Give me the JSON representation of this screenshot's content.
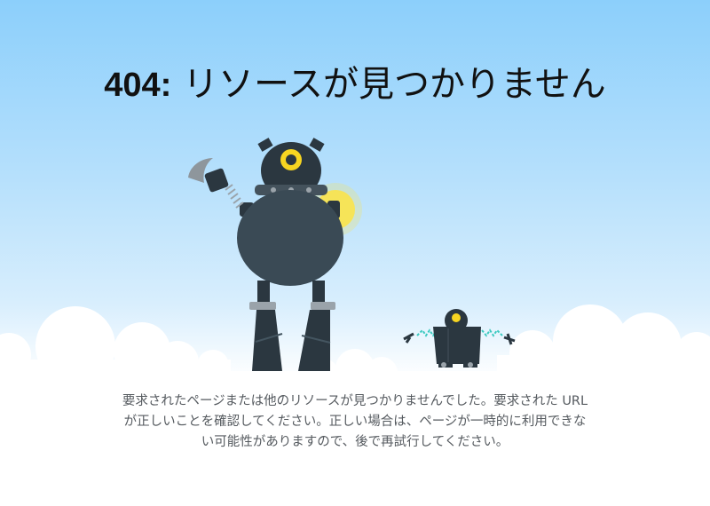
{
  "header": {
    "error_code": "404:",
    "title_text": "リソースが見つかりません"
  },
  "message": {
    "line1": "要求されたページまたは他のリソースが見つかりませんでした。要求された URL",
    "line2": "が正しいことを確認してください。正しい場合は、ページが一時的に利用できな",
    "line3": "い可能性がありますので、後で再試行してください。"
  },
  "illustration": {
    "big_robot": "large-robot-illustration",
    "small_robot": "small-robot-illustration",
    "colors": {
      "sky_top": "#8ccffb",
      "robot_body": "#3a4a55",
      "robot_dark": "#2b3740",
      "eye": "#f7d521",
      "glow": "#fbe34a",
      "cloud": "#ffffff",
      "spring": "#3ccac0"
    }
  }
}
